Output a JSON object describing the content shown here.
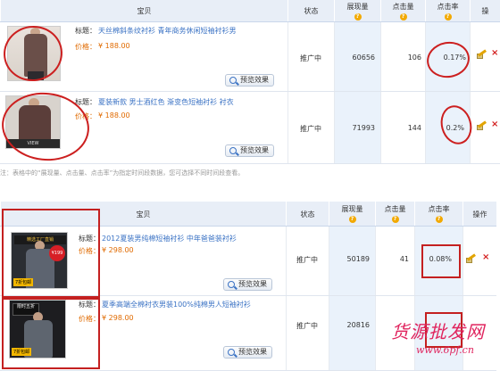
{
  "table1": {
    "headers": {
      "item": "宝贝",
      "status": "状态",
      "impressions": "展现量",
      "clicks": "点击量",
      "ctr": "点击率",
      "ops": "操"
    },
    "rows": [
      {
        "title_label": "标题：",
        "title": "天丝棉斜条纹衬衫 青年商务休闲短袖衬衫男",
        "price_label": "价格：",
        "price": "¥ 188.00",
        "preview": "预览效果",
        "status": "推广中",
        "impressions": "60656",
        "clicks": "106",
        "ctr": "0.17%"
      },
      {
        "title_label": "标题：",
        "title": "夏装新款 男士酒红色 渐变色短袖衬衫 衬衣",
        "price_label": "价格：",
        "price": "¥ 188.00",
        "preview": "预览效果",
        "status": "推广中",
        "impressions": "71993",
        "clicks": "144",
        "ctr": "0.2%"
      }
    ],
    "note": "注：表格中的“展现量、点击量、点击率”为指定时间段数据，您可选择不同时间段查看。"
  },
  "table2": {
    "headers": {
      "item": "宝贝",
      "status": "状态",
      "impressions": "展现量",
      "clicks": "点击量",
      "ctr": "点击率",
      "ops": "操作"
    },
    "rows": [
      {
        "title_label": "标题：",
        "title": "2012夏装男纯棉短袖衬衫 中年爸爸装衬衫",
        "price_label": "价格：",
        "price": "¥ 298.00",
        "preview": "预览效果",
        "status": "推广中",
        "impressions": "50189",
        "clicks": "41",
        "ctr": "0.08%",
        "thumb_tag": "精选工厂直销",
        "thumb_price": "¥199",
        "thumb_bottom": "7折包邮"
      },
      {
        "title_label": "标题：",
        "title": "夏季高端全棉衬衣男装100%纯棉男人短袖衬衫",
        "price_label": "价格：",
        "price": "¥ 298.00",
        "preview": "预览效果",
        "status": "推广中",
        "impressions": "20816",
        "clicks": "",
        "ctr": "",
        "thumb_tag": "限时五折",
        "thumb_bottom": "7折包邮"
      }
    ]
  },
  "watermark": {
    "big": "货源批发网",
    "small": "www.6pf.cn"
  },
  "colors": {
    "header_bg": "#e8eef7",
    "link": "#3a72c4",
    "price": "#e06a00",
    "annotation": "#cc1f1f",
    "watermark": "#e0245e"
  },
  "icons": [
    "help-question-icon",
    "magnifier-icon",
    "edit-icon",
    "delete-icon"
  ]
}
